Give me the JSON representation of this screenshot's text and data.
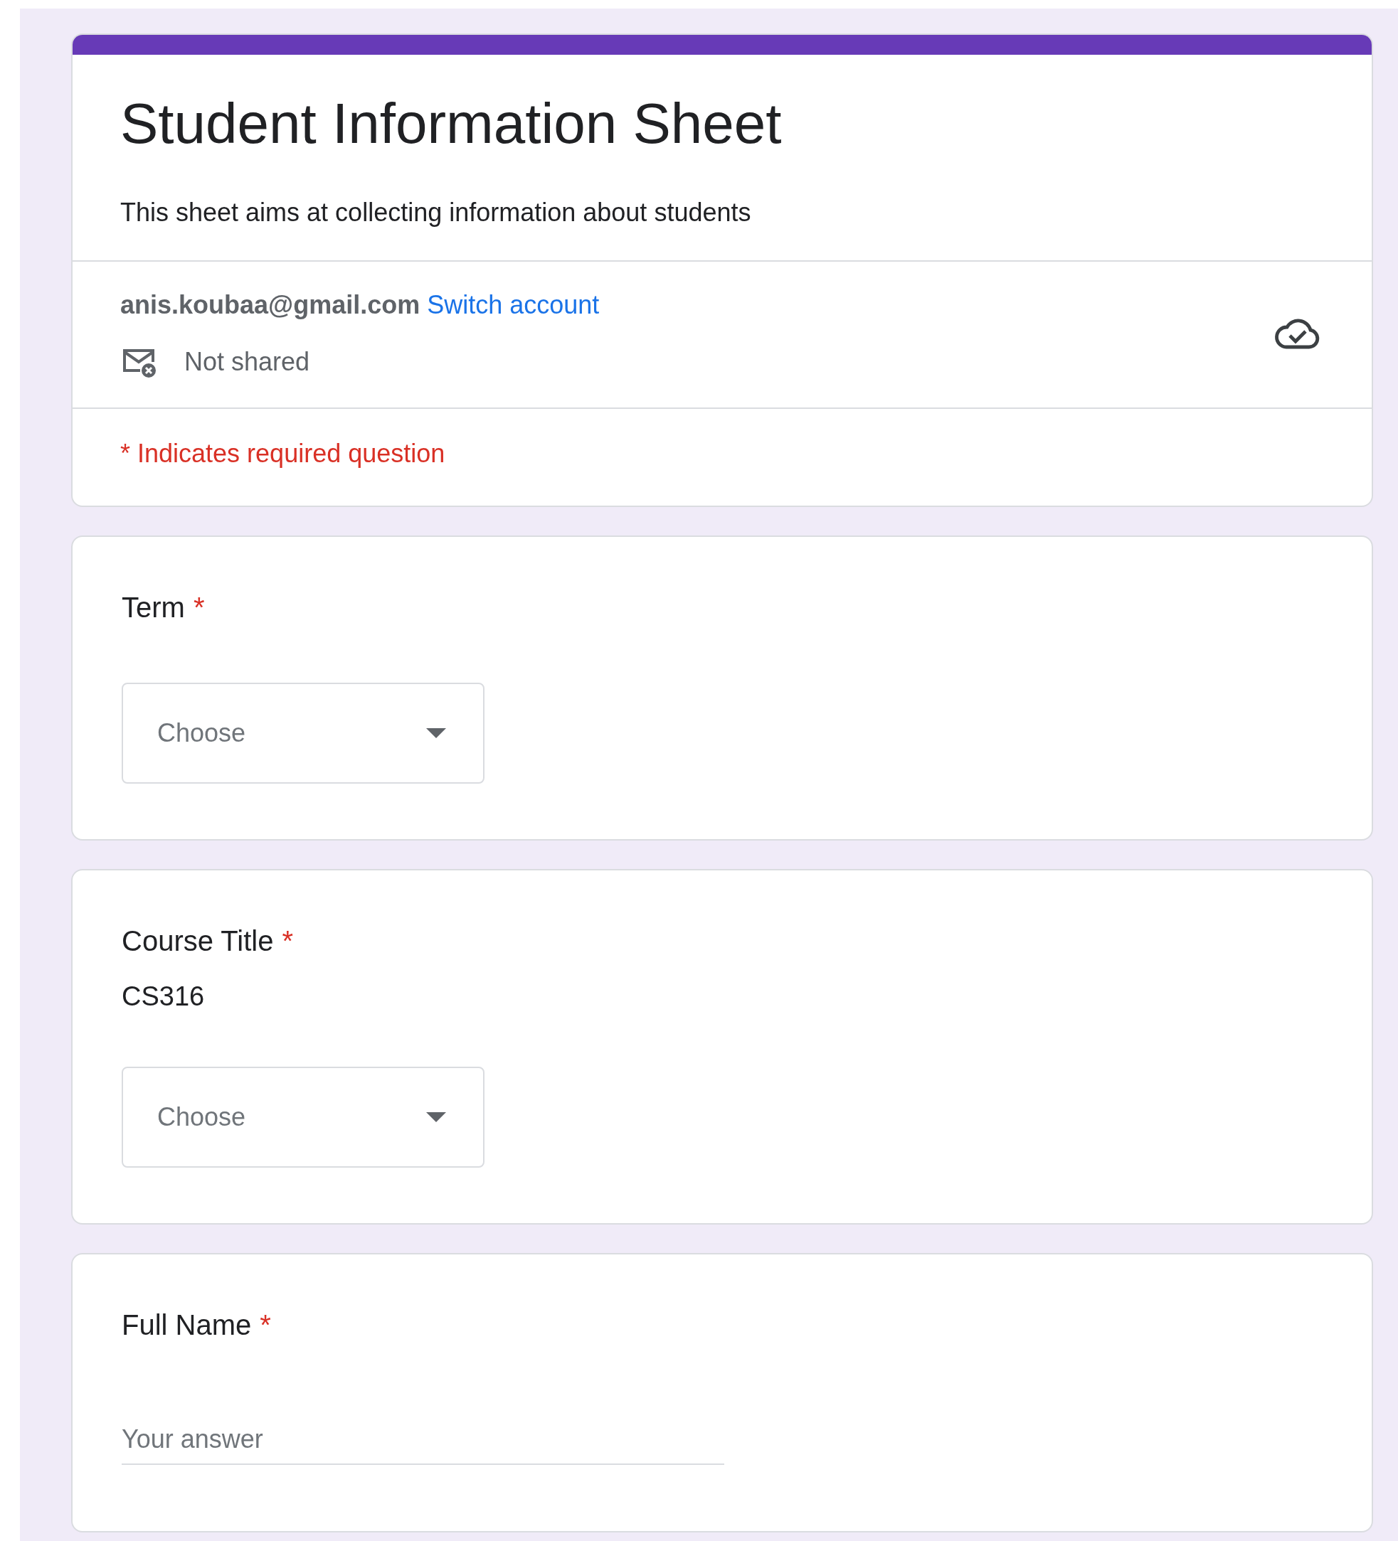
{
  "form": {
    "title": "Student Information Sheet",
    "description": "This sheet aims at collecting information about students"
  },
  "account": {
    "email": "anis.koubaa@gmail.com",
    "switch_link": "Switch account",
    "sharing": "Not shared"
  },
  "required_note": "* Indicates required question",
  "required_mark": "*",
  "questions": [
    {
      "kind": "dropdown",
      "title": "Term",
      "required": true,
      "placeholder": "Choose"
    },
    {
      "kind": "dropdown",
      "title": "Course Title",
      "required": true,
      "description": "CS316",
      "placeholder": "Choose"
    },
    {
      "kind": "text",
      "title": "Full Name",
      "required": true,
      "placeholder": "Your answer"
    }
  ]
}
